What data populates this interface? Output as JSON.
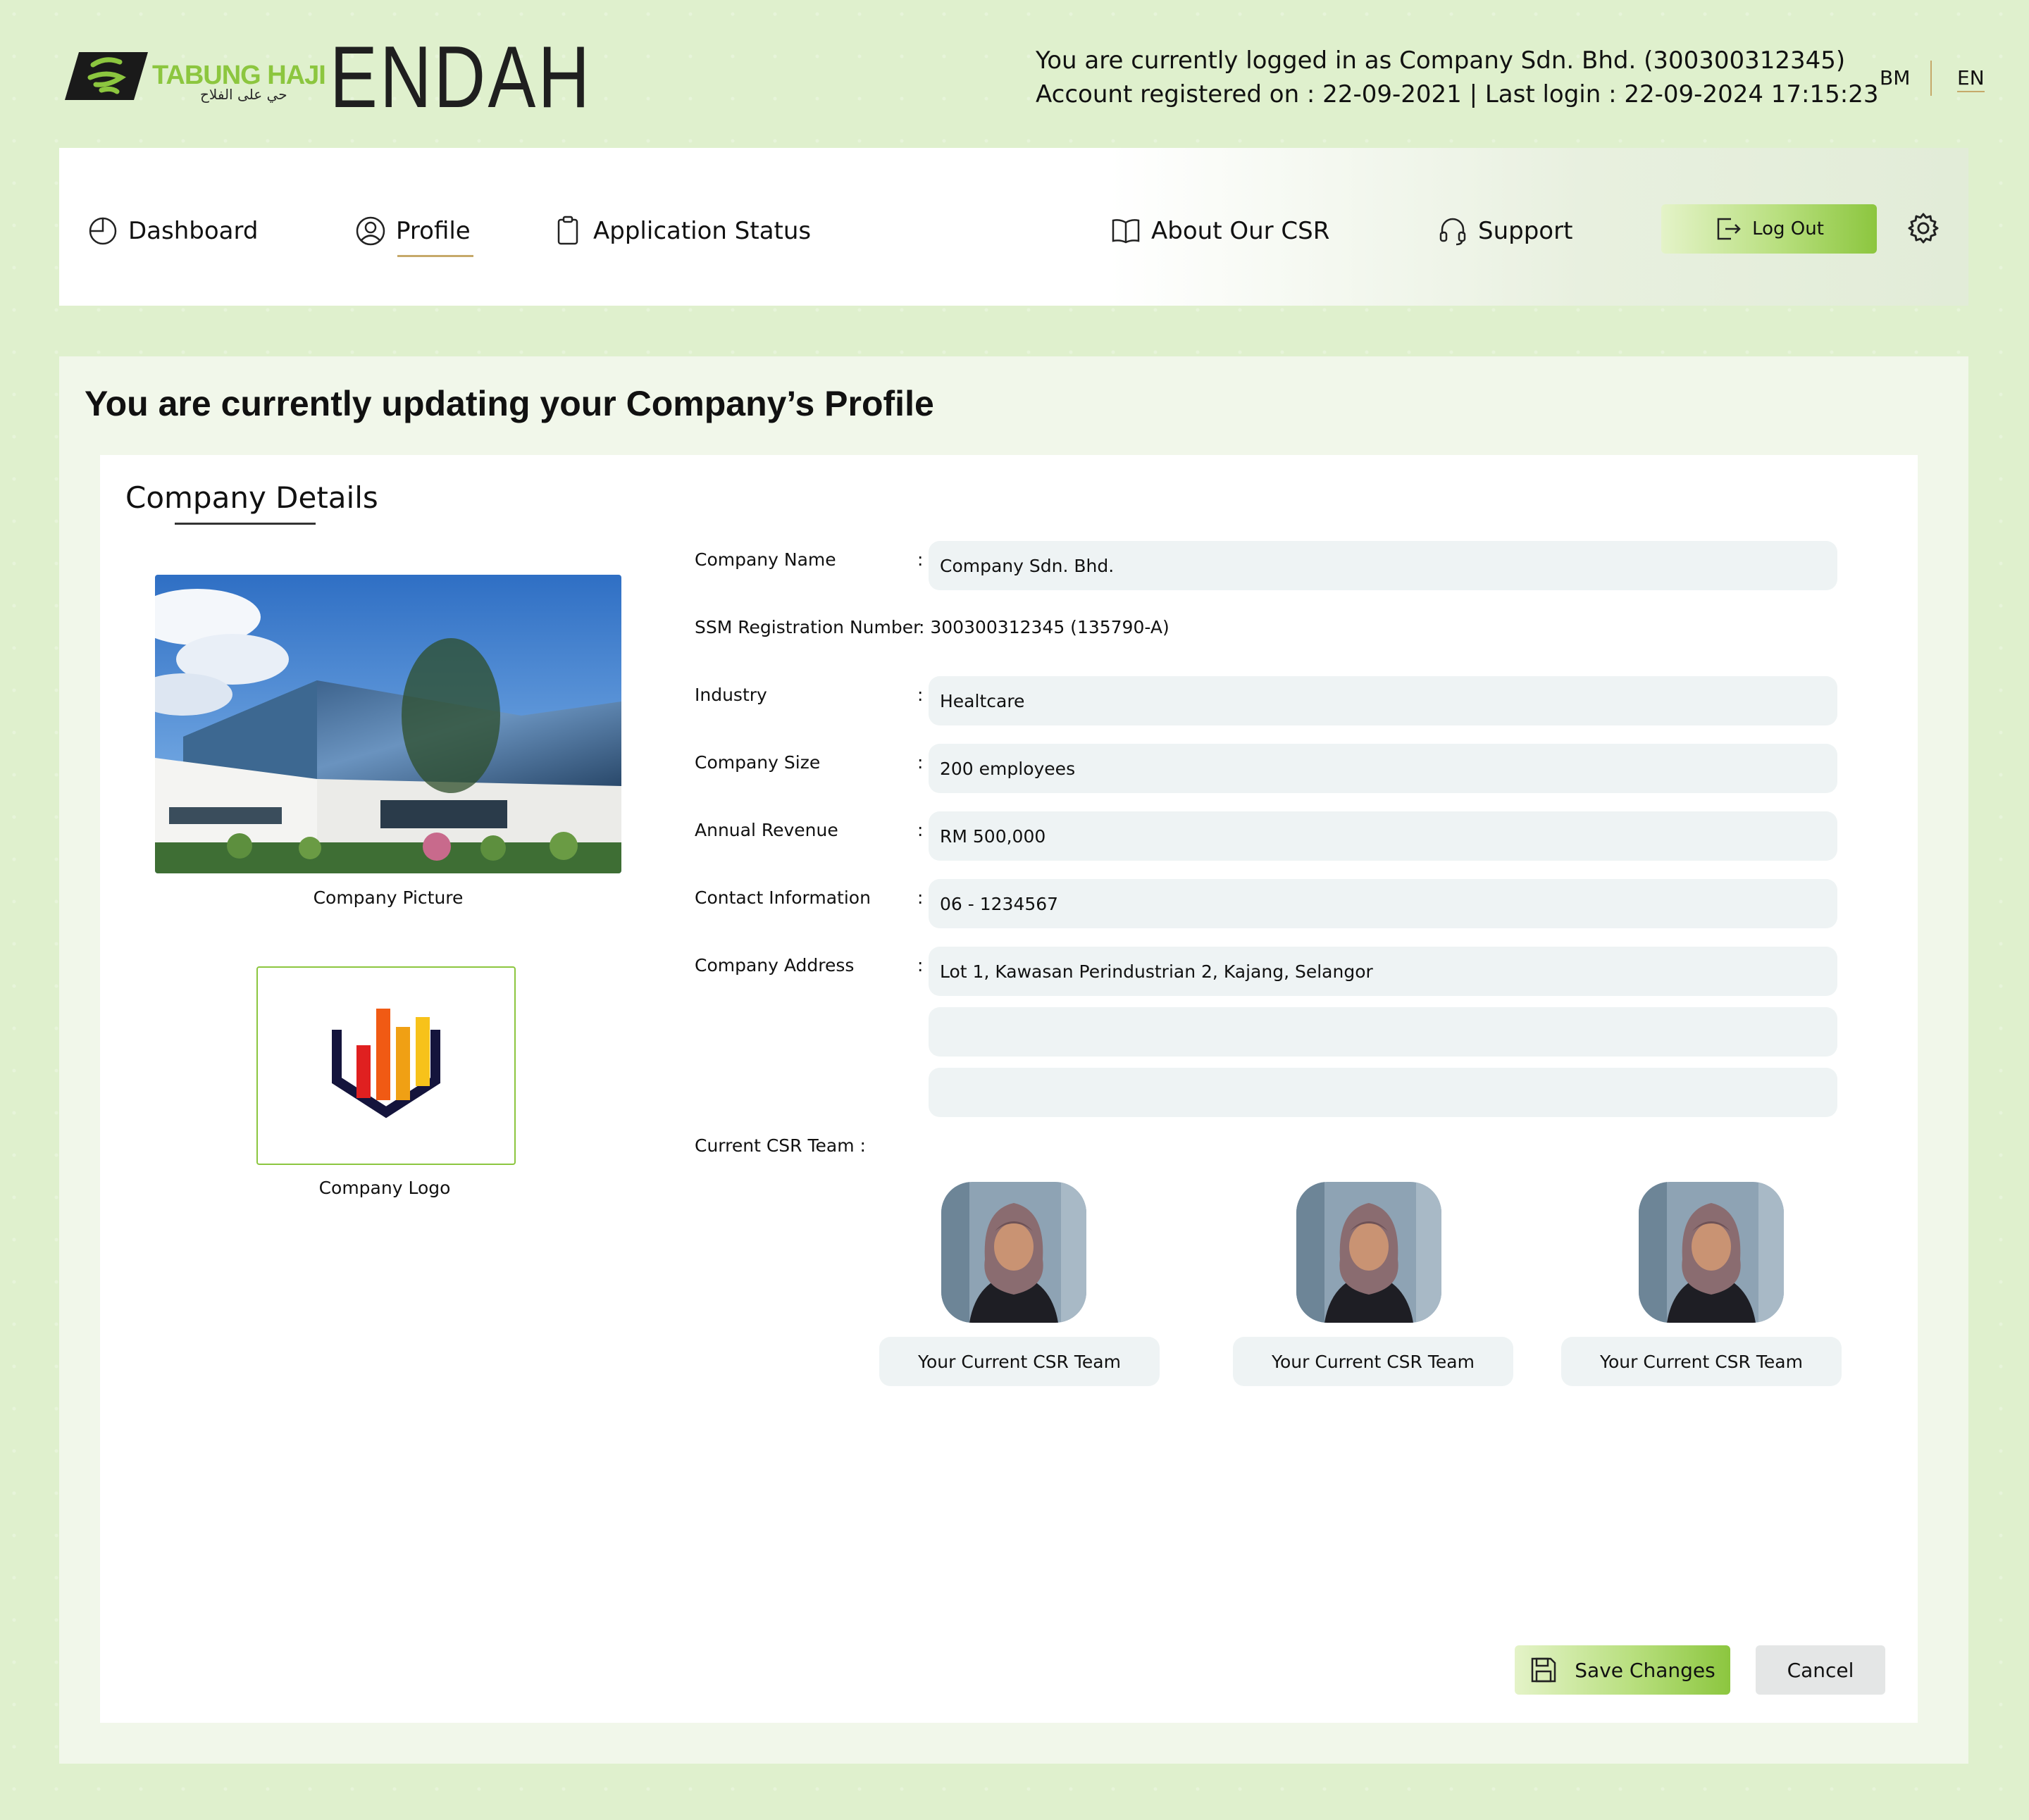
{
  "header": {
    "brand_name": "TABUNG HAJI",
    "brand_tagline": "حي على الفلاح",
    "app_name": "ENDAH",
    "login_line": "You are currently logged in as Company Sdn. Bhd. (300300312345)",
    "account_line": "Account registered on : 22-09-2021 | Last login : 22-09-2024 17:15:23",
    "languages": [
      "BM",
      "EN"
    ],
    "active_language": "EN"
  },
  "nav": {
    "items": [
      {
        "label": "Dashboard",
        "icon": "pie-chart-icon"
      },
      {
        "label": "Profile",
        "icon": "user-circle-icon"
      },
      {
        "label": "Application Status",
        "icon": "clipboard-icon"
      },
      {
        "label": "About Our CSR",
        "icon": "book-open-icon"
      },
      {
        "label": "Support",
        "icon": "headset-icon"
      }
    ],
    "active_item": "Profile",
    "logout_label": "Log Out",
    "settings_icon": "gear-icon"
  },
  "page": {
    "title": "You are currently updating your Company’s Profile",
    "section_title": "Company Details",
    "company_picture_caption": "Company Picture",
    "company_logo_caption": "Company Logo"
  },
  "form": {
    "company_name": {
      "label": "Company Name",
      "value": "Company Sdn. Bhd."
    },
    "ssm": {
      "label": "SSM Registration Number",
      "value": ": 300300312345 (135790-A)"
    },
    "industry": {
      "label": "Industry",
      "value": "Healtcare"
    },
    "company_size": {
      "label": "Company Size",
      "value": "200 employees"
    },
    "annual_revenue": {
      "label": "Annual Revenue",
      "value": "RM 500,000"
    },
    "contact": {
      "label": "Contact Information",
      "value": "06 - 1234567"
    },
    "address": {
      "label": "Company Address",
      "line1": "Lot 1, Kawasan Perindustrian 2, Kajang, Selangor",
      "line2": "",
      "line3": ""
    },
    "colon": ":"
  },
  "team": {
    "label": "Current CSR Team :",
    "members": [
      {
        "caption": "Your Current CSR Team"
      },
      {
        "caption": "Your Current CSR Team"
      },
      {
        "caption": "Your Current CSR Team"
      }
    ]
  },
  "actions": {
    "save_label": "Save Changes",
    "cancel_label": "Cancel"
  },
  "colors": {
    "accent_green": "#8cc63f",
    "accent_gold": "#c6a96a",
    "page_bg": "#dff0cd",
    "input_bg": "#eef3f4"
  }
}
